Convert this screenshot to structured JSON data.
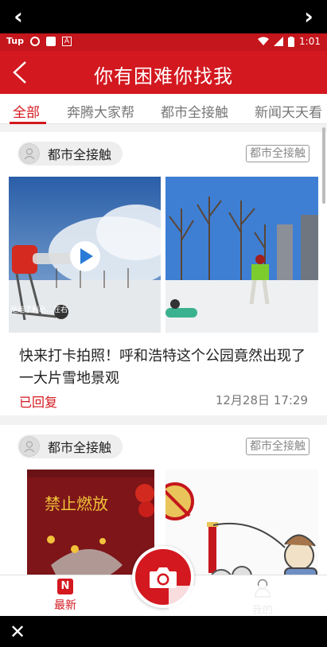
{
  "browser": {
    "back_icon": "chevron-left-icon",
    "forward_icon": "chevron-right-icon",
    "close_icon": "close-icon"
  },
  "status_bar": {
    "carrier": "Tup",
    "time": "1:01"
  },
  "header": {
    "title": "你有困难你找我"
  },
  "tabs": [
    {
      "label": "全部",
      "active": true
    },
    {
      "label": "奔腾大家帮",
      "active": false
    },
    {
      "label": "都市全接触",
      "active": false
    },
    {
      "label": "新闻天天看",
      "active": false
    }
  ],
  "posts": [
    {
      "source": "都市全接触",
      "tag": "都市全接触",
      "title": "快来打卡拍照！呼和浩特这个公园竟然出现了一大片雪地景观",
      "status": "已回复",
      "time": "12月28日 17:29",
      "image_caption": "是运了利必…在右"
    },
    {
      "source": "都市全接触",
      "tag": "都市全接触",
      "poster_text": "禁止燃放"
    }
  ],
  "bottom_nav": {
    "latest_badge": "N",
    "latest": "最新",
    "mine": "我的"
  },
  "colors": {
    "brand_red": "#d3181f",
    "status_red": "#c4161c"
  }
}
